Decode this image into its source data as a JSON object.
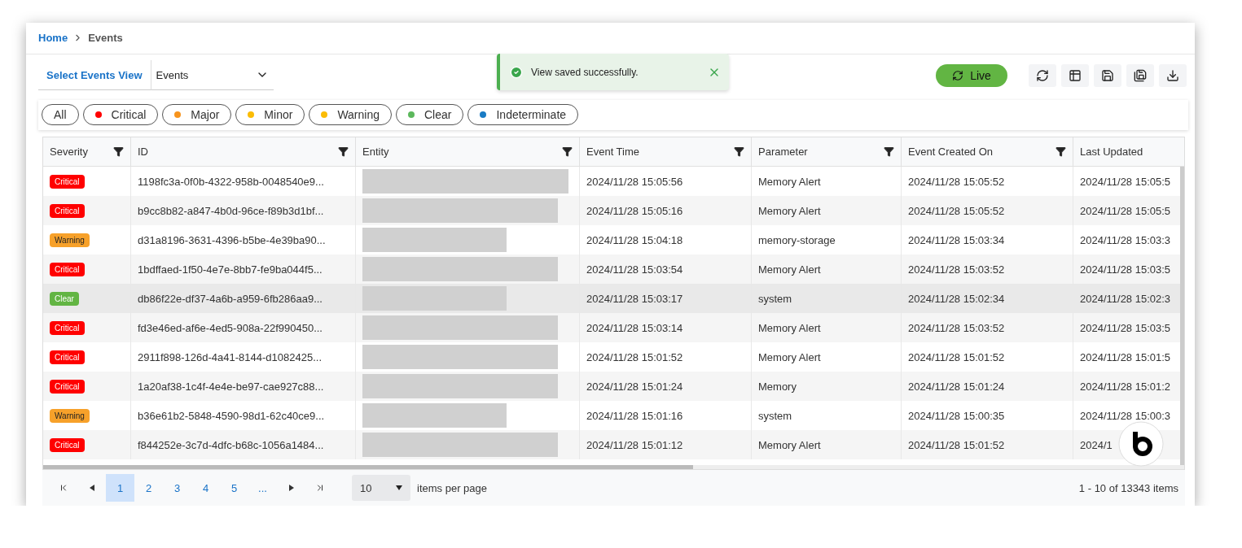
{
  "breadcrumb": [
    {
      "label": "Home",
      "link": true
    },
    {
      "label": "Events",
      "link": false
    }
  ],
  "view_selector": {
    "label": "Select Events View",
    "value": "Events"
  },
  "toast": {
    "message": "View saved successfully."
  },
  "live_button": {
    "label": "Live"
  },
  "toolbar_icons": [
    {
      "kind": "refresh"
    },
    {
      "kind": "columns"
    },
    {
      "kind": "save"
    },
    {
      "kind": "save-as"
    },
    {
      "kind": "download"
    }
  ],
  "filter_chips": [
    {
      "label": "All"
    },
    {
      "label": "Critical",
      "color": "#ff0000"
    },
    {
      "label": "Major",
      "color": "#f7941d"
    },
    {
      "label": "Minor",
      "color": "#fbbc05"
    },
    {
      "label": "Warning",
      "color": "#fbbc05"
    },
    {
      "label": "Clear",
      "color": "#5cb85c"
    },
    {
      "label": "Indeterminate",
      "color": "#1a7bc4"
    }
  ],
  "table": {
    "columns": [
      {
        "label": "Severity",
        "filter": true
      },
      {
        "label": "ID",
        "filter": true
      },
      {
        "label": "Entity",
        "filter": true
      },
      {
        "label": "Event Time",
        "filter": true
      },
      {
        "label": "Parameter",
        "filter": true
      },
      {
        "label": "Event Created On",
        "filter": true
      },
      {
        "label": "Last Updated",
        "filter": false
      }
    ],
    "rows": [
      {
        "severity": {
          "label": "Critical",
          "kind": "critical"
        },
        "id": "1198fc3a-0f0b-4322-958b-0048540e9...",
        "entity": {
          "kind": "redacted-full"
        },
        "event_time": "2024/11/28 15:05:56",
        "parameter": "Memory Alert",
        "created_on": "2024/11/28 15:05:52",
        "last_updated": "2024/11/28 15:05:5",
        "selected": false
      },
      {
        "severity": {
          "label": "Critical",
          "kind": "critical"
        },
        "id": "b9cc8b82-a847-4b0d-96ce-f89b3d1bf...",
        "entity": {
          "kind": "redacted-long"
        },
        "event_time": "2024/11/28 15:05:16",
        "parameter": "Memory Alert",
        "created_on": "2024/11/28 15:05:52",
        "last_updated": "2024/11/28 15:05:5",
        "selected": false
      },
      {
        "severity": {
          "label": "Warning",
          "kind": "warning"
        },
        "id": "d31a8196-3631-4396-b5be-4e39ba90...",
        "entity": {
          "kind": "redacted-short"
        },
        "event_time": "2024/11/28 15:04:18",
        "parameter": "memory-storage",
        "created_on": "2024/11/28 15:03:34",
        "last_updated": "2024/11/28 15:03:3",
        "selected": false
      },
      {
        "severity": {
          "label": "Critical",
          "kind": "critical"
        },
        "id": "1bdffaed-1f50-4e7e-8bb7-fe9ba044f5...",
        "entity": {
          "kind": "redacted-long"
        },
        "event_time": "2024/11/28 15:03:54",
        "parameter": "Memory Alert",
        "created_on": "2024/11/28 15:03:52",
        "last_updated": "2024/11/28 15:03:5",
        "selected": false
      },
      {
        "severity": {
          "label": "Clear",
          "kind": "clear"
        },
        "id": "db86f22e-df37-4a6b-a959-6fb286aa9...",
        "entity": {
          "kind": "redacted-short"
        },
        "event_time": "2024/11/28 15:03:17",
        "parameter": "system",
        "created_on": "2024/11/28 15:02:34",
        "last_updated": "2024/11/28 15:02:3",
        "selected": true
      },
      {
        "severity": {
          "label": "Critical",
          "kind": "critical"
        },
        "id": "fd3e46ed-af6e-4ed5-908a-22f990450...",
        "entity": {
          "kind": "redacted-long"
        },
        "event_time": "2024/11/28 15:03:14",
        "parameter": "Memory Alert",
        "created_on": "2024/11/28 15:03:52",
        "last_updated": "2024/11/28 15:03:5",
        "selected": false
      },
      {
        "severity": {
          "label": "Critical",
          "kind": "critical"
        },
        "id": "2911f898-126d-4a41-8144-d1082425...",
        "entity": {
          "kind": "redacted-long"
        },
        "event_time": "2024/11/28 15:01:52",
        "parameter": "Memory Alert",
        "created_on": "2024/11/28 15:01:52",
        "last_updated": "2024/11/28 15:01:5",
        "selected": false
      },
      {
        "severity": {
          "label": "Critical",
          "kind": "critical"
        },
        "id": "1a20af38-1c4f-4e4e-be97-cae927c88...",
        "entity": {
          "kind": "redacted-long"
        },
        "event_time": "2024/11/28 15:01:24",
        "parameter": "Memory",
        "created_on": "2024/11/28 15:01:24",
        "last_updated": "2024/11/28 15:01:2",
        "selected": false
      },
      {
        "severity": {
          "label": "Warning",
          "kind": "warning"
        },
        "id": "b36e61b2-5848-4590-98d1-62c40ce9...",
        "entity": {
          "kind": "redacted-short"
        },
        "event_time": "2024/11/28 15:01:16",
        "parameter": "system",
        "created_on": "2024/11/28 15:00:35",
        "last_updated": "2024/11/28 15:00:3",
        "selected": false
      },
      {
        "severity": {
          "label": "Critical",
          "kind": "critical"
        },
        "id": "f844252e-3c7d-4dfc-b68c-1056a1484...",
        "entity": {
          "kind": "redacted-long"
        },
        "event_time": "2024/11/28 15:01:12",
        "parameter": "Memory Alert",
        "created_on": "2024/11/28 15:01:52",
        "last_updated": "2024/1",
        "selected": false
      }
    ]
  },
  "pagination": {
    "pages": [
      {
        "label": "1",
        "selected": true
      },
      {
        "label": "2",
        "selected": false
      },
      {
        "label": "3",
        "selected": false
      },
      {
        "label": "4",
        "selected": false
      },
      {
        "label": "5",
        "selected": false
      },
      {
        "label": "...",
        "selected": false
      }
    ],
    "page_size": "10",
    "page_size_label": "items per page",
    "summary": "1 - 10 of 13343 items"
  }
}
